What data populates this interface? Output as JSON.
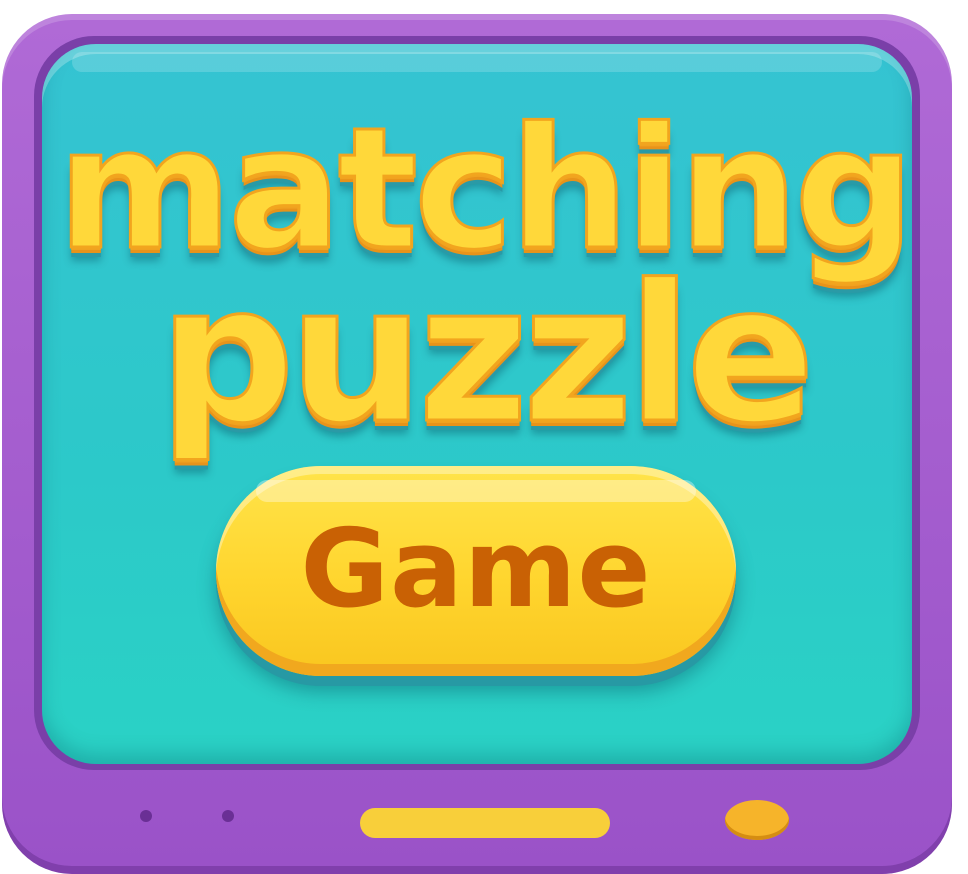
{
  "title": {
    "line1": "matching",
    "line2": "puzzle"
  },
  "start_button": {
    "label": "Game"
  },
  "colors": {
    "frame": "#a45ccf",
    "screen": "#2ec8cc",
    "title_fill": "#ffd83a",
    "button_fill": "#ffd52e",
    "button_text": "#c96104"
  }
}
